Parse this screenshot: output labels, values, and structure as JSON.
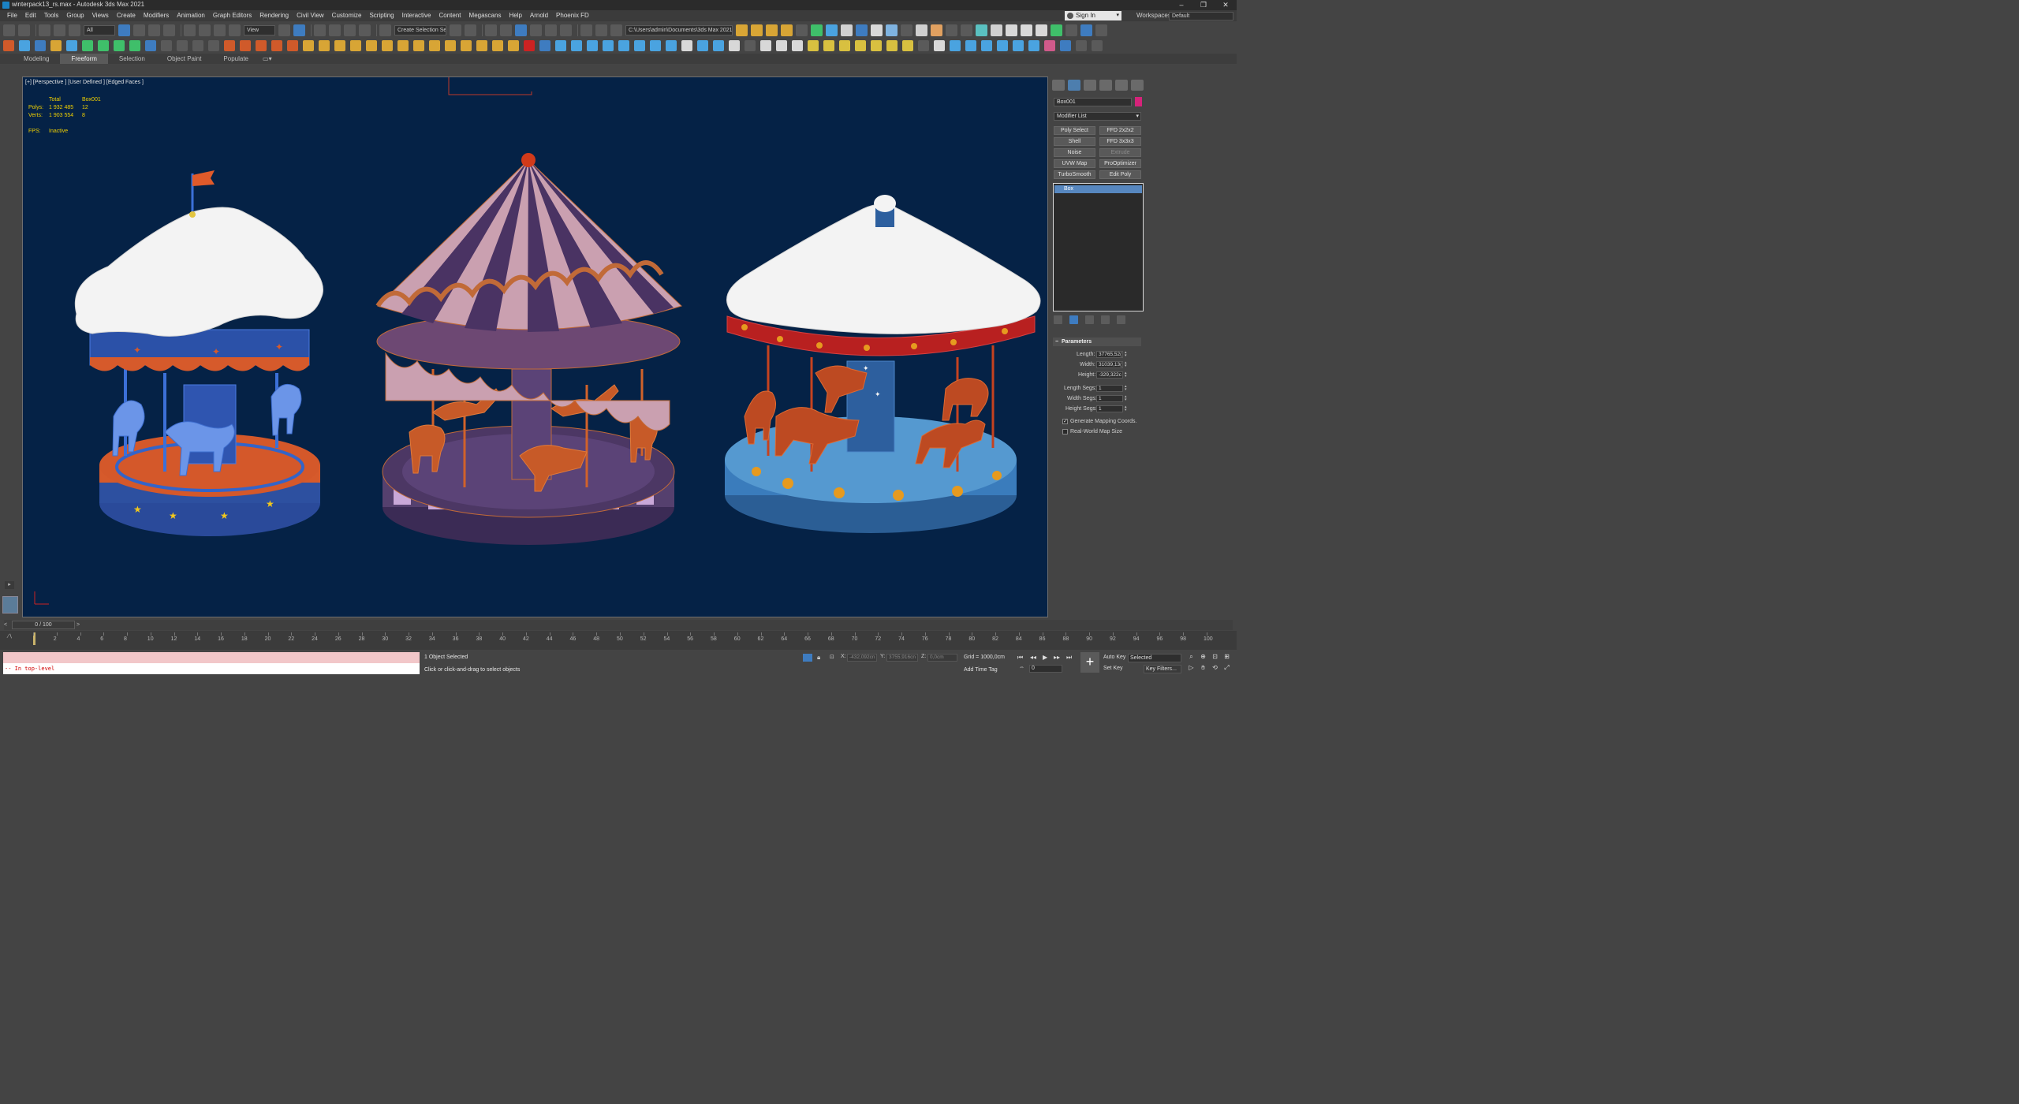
{
  "window": {
    "title": "winterpack13_rs.max - Autodesk 3ds Max 2021",
    "controls": [
      "–",
      "❐",
      "✕"
    ]
  },
  "menu": {
    "items": [
      "File",
      "Edit",
      "Tools",
      "Group",
      "Views",
      "Create",
      "Modifiers",
      "Animation",
      "Graph Editors",
      "Rendering",
      "Civil View",
      "Customize",
      "Scripting",
      "Interactive",
      "Content",
      "Megascans",
      "Help",
      "Arnold",
      "Phoenix FD"
    ],
    "sign_in": "Sign In",
    "workspaces_label": "Workspaces:",
    "workspaces_value": "Default"
  },
  "toolbar": {
    "filter_dropdown": "All",
    "refcoord_dropdown": "View",
    "selection_set": "Create Selection Se",
    "project_path": "C:\\Users\\admin\\Documents\\3ds Max 2021"
  },
  "ribbon": {
    "tabs": [
      "Modeling",
      "Freeform",
      "Selection",
      "Object Paint",
      "Populate"
    ],
    "active": "Freeform"
  },
  "viewport": {
    "label": "[+] [Perspective ] [User Defined ] [Edged Faces ]",
    "stats": {
      "header_total": "Total",
      "header_object": "Box001",
      "polys_label": "Polys:",
      "polys_total": "1 932 485",
      "polys_object": "12",
      "verts_label": "Verts:",
      "verts_total": "1 903 554",
      "verts_object": "8",
      "fps_label": "FPS:",
      "fps_value": "Inactive"
    },
    "colors": {
      "background": "#052246",
      "snow": "#f2f2f2",
      "wire_orange": "#d4581f",
      "wire_blue": "#3d72d6"
    }
  },
  "command_panel": {
    "object_name": "Box001",
    "object_color": "#d6237a",
    "modifier_list": "Modifier List",
    "modifier_buttons": [
      {
        "label": "Poly Select",
        "enabled": true
      },
      {
        "label": "FFD 2x2x2",
        "enabled": true
      },
      {
        "label": "Shell",
        "enabled": true
      },
      {
        "label": "FFD 3x3x3",
        "enabled": true
      },
      {
        "label": "Noise",
        "enabled": true
      },
      {
        "label": "Extrude",
        "enabled": false
      },
      {
        "label": "UVW Map",
        "enabled": true
      },
      {
        "label": "ProOptimizer",
        "enabled": true
      },
      {
        "label": "TurboSmooth",
        "enabled": true
      },
      {
        "label": "Edit Poly",
        "enabled": true
      }
    ],
    "stack_item": "Box",
    "parameters": {
      "title": "Parameters",
      "length_label": "Length:",
      "length_value": "37765,52(",
      "width_label": "Width:",
      "width_value": "31039,13(",
      "height_label": "Height:",
      "height_value": "-329,322c",
      "length_segs_label": "Length Segs:",
      "length_segs_value": "1",
      "width_segs_label": "Width Segs:",
      "width_segs_value": "1",
      "height_segs_label": "Height Segs:",
      "height_segs_value": "1",
      "gen_mapping_label": "Generate Mapping Coords.",
      "gen_mapping_checked": true,
      "real_world_label": "Real-World Map Size",
      "real_world_checked": false
    }
  },
  "timeline": {
    "slider_label": "0 / 100",
    "current_frame": 0,
    "total_frames": 100,
    "ticks": [
      "0",
      "2",
      "4",
      "6",
      "8",
      "10",
      "12",
      "14",
      "16",
      "18",
      "20",
      "22",
      "24",
      "26",
      "28",
      "30",
      "32",
      "34",
      "36",
      "38",
      "40",
      "42",
      "44",
      "46",
      "48",
      "50",
      "52",
      "54",
      "56",
      "58",
      "60",
      "62",
      "64",
      "66",
      "68",
      "70",
      "72",
      "74",
      "76",
      "78",
      "80",
      "82",
      "84",
      "86",
      "88",
      "90",
      "92",
      "94",
      "96",
      "98",
      "100"
    ]
  },
  "status": {
    "maxscript_output": "-- In top-level",
    "selected": "1 Object Selected",
    "prompt": "Click or click-and-drag to select objects",
    "x_label": "X:",
    "x_value": "-432,092cn",
    "y_label": "Y:",
    "y_value": "3755,916cn",
    "z_label": "Z:",
    "z_value": "0,0cm",
    "grid": "Grid = 1000,0cm",
    "add_time_tag": "Add Time Tag",
    "auto_key": "Auto Key",
    "set_key": "Set Key",
    "selected_dropdown": "Selected",
    "key_filters": "Key Filters...",
    "frame_value": "0"
  }
}
